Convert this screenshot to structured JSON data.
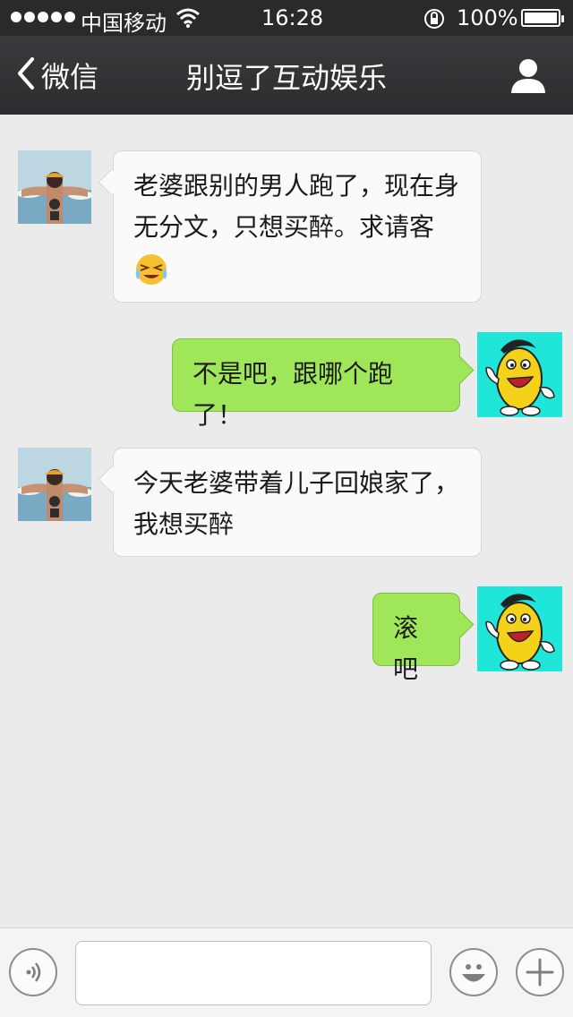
{
  "status_bar": {
    "carrier": "中国移动",
    "time": "16:28",
    "battery": "100%"
  },
  "nav": {
    "back_label": "微信",
    "title": "别逗了互动娱乐"
  },
  "messages": [
    {
      "side": "left",
      "sender": "contact",
      "text": "老婆跟别的男人跑了，现在身无分文，只想买醉。求请客",
      "emoji": "crying-laughing-emoji"
    },
    {
      "side": "right",
      "sender": "me",
      "text": "不是吧，跟哪个跑了！"
    },
    {
      "side": "left",
      "sender": "contact",
      "text": "今天老婆带着儿子回娘家了，我想买醉"
    },
    {
      "side": "right",
      "sender": "me",
      "text": "滚吧"
    }
  ],
  "input": {
    "value": "",
    "placeholder": ""
  },
  "colors": {
    "nav_bg": "#2d2d30",
    "chat_bg": "#ebebeb",
    "my_bubble": "#9fe658",
    "their_bubble": "#fafafa",
    "my_avatar_bg": "#1fe6d9"
  },
  "icons": [
    "back-chevron-icon",
    "person-icon",
    "voice-icon",
    "smiley-icon",
    "plus-icon",
    "wifi-icon",
    "lock-rotation-icon"
  ]
}
